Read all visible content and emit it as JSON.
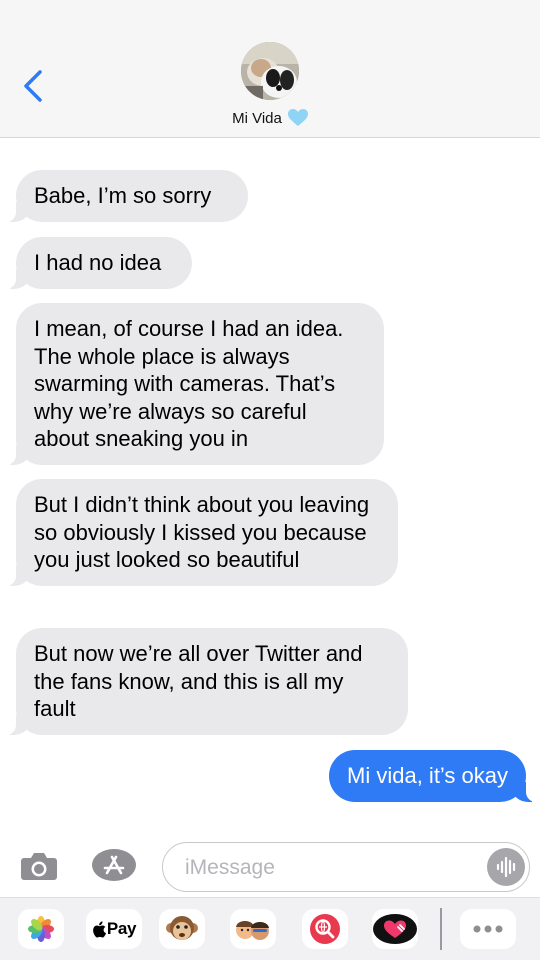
{
  "header": {
    "contact_name": "Mi Vida",
    "heart_color": "#8fd3f5"
  },
  "messages": [
    {
      "from": "contact",
      "text": "Babe, I’m so sorry"
    },
    {
      "from": "contact",
      "text": "I had no idea"
    },
    {
      "from": "contact",
      "text": "I mean, of course I had an idea. The whole place is always swarming with cameras. That’s why we’re always so careful about sneaking you in"
    },
    {
      "from": "contact",
      "text": "But I didn’t think about you leaving so obviously I kissed you because you just looked so beautiful"
    },
    {
      "from": "contact",
      "text": "But now we’re all over Twitter and the fans know, and this is all my fault"
    },
    {
      "from": "me",
      "text": "Mi vida, it’s okay"
    }
  ],
  "input": {
    "placeholder": "iMessage",
    "value": ""
  },
  "app_drawer": {
    "apple_pay_label": "Pay",
    "icons": [
      "photos-icon",
      "apple-pay-icon",
      "monkey-animoji-icon",
      "memoji-stickers-icon",
      "web-search-icon",
      "digital-touch-icon",
      "more-apps-icon"
    ]
  },
  "colors": {
    "incoming_bubble": "#e9e9eb",
    "outgoing_bubble": "#2f7bf5",
    "accent": "#2f7bf5"
  }
}
